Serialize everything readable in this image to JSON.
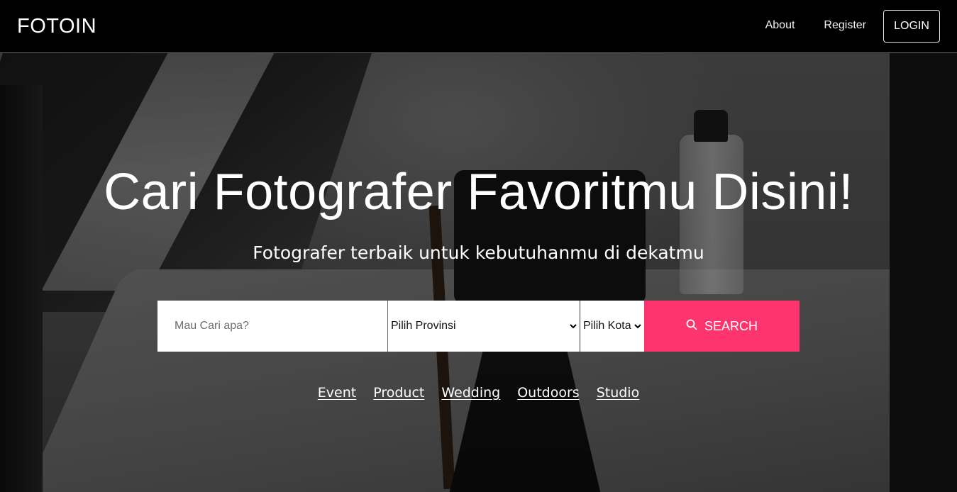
{
  "navbar": {
    "brand": "FOTOIN",
    "links": [
      "About",
      "Register"
    ],
    "login_label": "LOGIN"
  },
  "hero": {
    "title": "Cari Fotografer Favoritmu Disini!",
    "subtitle": "Fotografer terbaik untuk kebutuhanmu di dekatmu"
  },
  "search": {
    "placeholder": "Mau Cari apa?",
    "province_selected": "Pilih Provinsi",
    "city_selected": "Pilih Kota",
    "button_label": "SEARCH"
  },
  "categories": [
    "Event",
    "Product",
    "Wedding",
    "Outdoors",
    "Studio"
  ],
  "colors": {
    "accent": "#fe346e",
    "navbar_bg": "#000000"
  }
}
